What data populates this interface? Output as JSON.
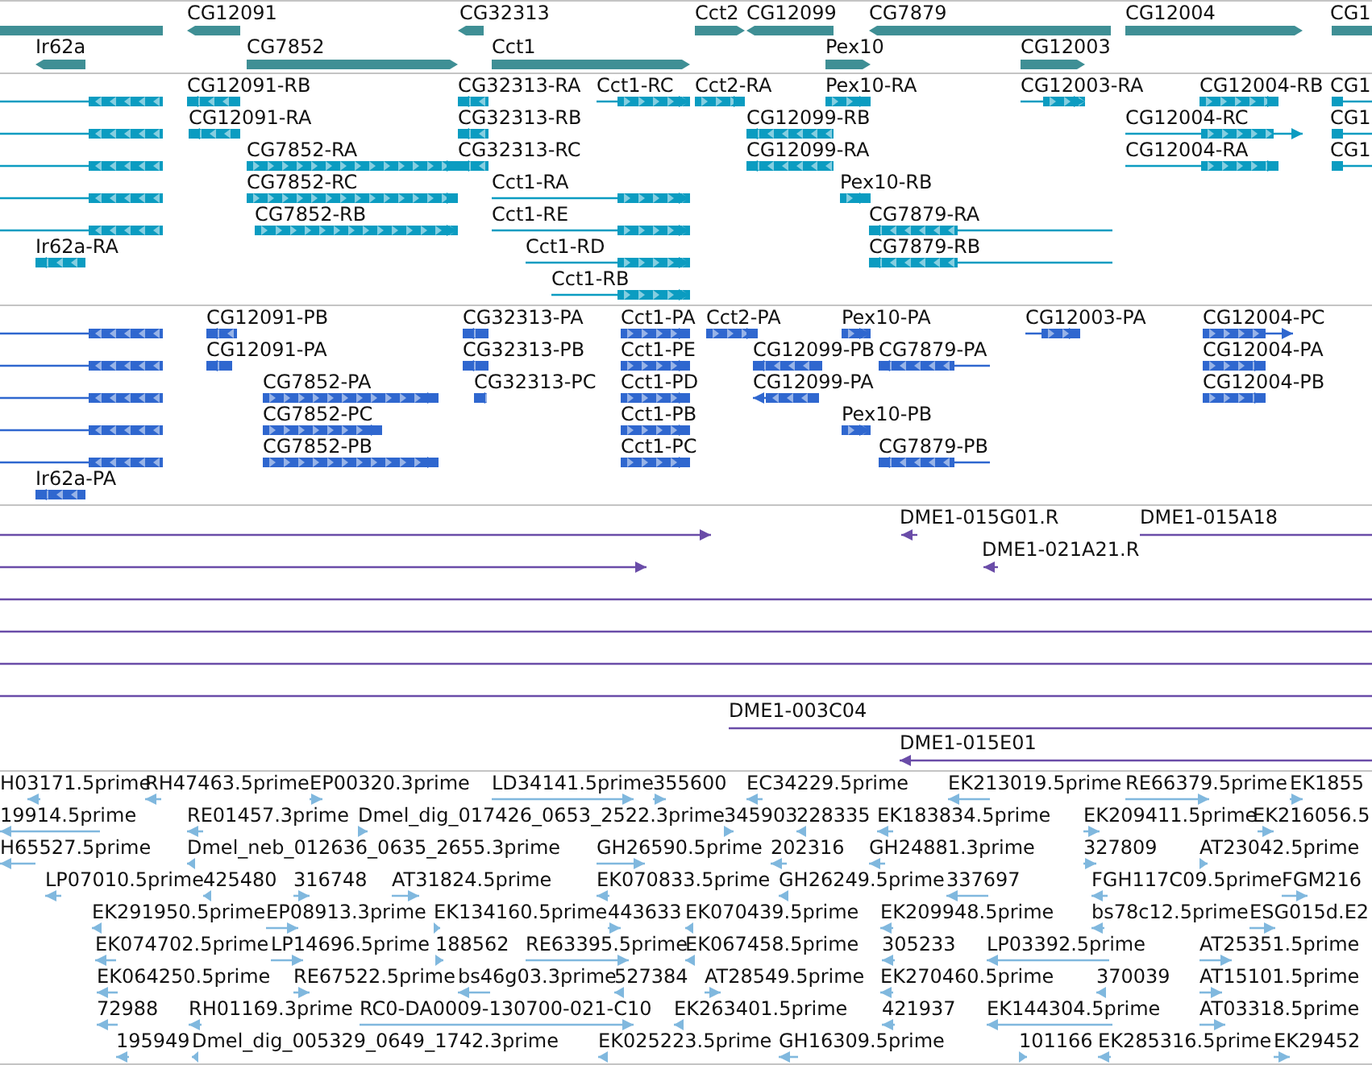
{
  "tracks": [
    {
      "kind": "gene",
      "features": [
        {
          "reverse": true
        },
        {
          "label": "CG12091",
          "reverse": true
        },
        {
          "label": "CG32313",
          "reverse": true
        },
        {
          "label": "Cct2",
          "reverse": false
        },
        {
          "label": "CG12099",
          "reverse": true
        },
        {
          "label": "CG7879",
          "reverse": true
        },
        {
          "label": "CG12004",
          "reverse": false
        },
        {
          "label": "CG1",
          "reverse": false
        },
        {
          "label": "Ir62a",
          "reverse": true
        },
        {
          "label": "CG7852",
          "reverse": false
        },
        {
          "label": "Cct1",
          "reverse": false
        },
        {
          "label": "Pex10",
          "reverse": false
        },
        {
          "label": "CG12003",
          "reverse": false
        }
      ]
    },
    {
      "kind": "transcript",
      "features": [
        {
          "reverse": true
        },
        {
          "label": "CG12091-RB",
          "reverse": true
        },
        {
          "label": "CG32313-RA",
          "reverse": true
        },
        {
          "label": "Cct1-RC",
          "reverse": false
        },
        {
          "label": "Cct2-RA",
          "reverse": false
        },
        {
          "label": "Pex10-RA",
          "reverse": false
        },
        {
          "label": "CG12003-RA",
          "reverse": false
        },
        {
          "label": "CG12004-RB",
          "reverse": false
        },
        {
          "label": "CG1",
          "reverse": false
        },
        {
          "reverse": true
        },
        {
          "label": "CG12091-RA",
          "reverse": true
        },
        {
          "label": "CG32313-RB",
          "reverse": true
        },
        {
          "label": "CG12099-RB",
          "reverse": true
        },
        {
          "label": "CG12004-RC",
          "reverse": false
        },
        {
          "label": "CG1",
          "reverse": false
        },
        {
          "reverse": true
        },
        {
          "label": "CG7852-RA",
          "reverse": false
        },
        {
          "label": "CG32313-RC",
          "reverse": true
        },
        {
          "label": "CG12099-RA",
          "reverse": true
        },
        {
          "label": "CG12004-RA",
          "reverse": false
        },
        {
          "label": "CG1",
          "reverse": false
        },
        {
          "reverse": true
        },
        {
          "label": "CG7852-RC",
          "reverse": false
        },
        {
          "label": "Cct1-RA",
          "reverse": false
        },
        {
          "label": "Pex10-RB",
          "reverse": false
        },
        {
          "reverse": true
        },
        {
          "label": "CG7852-RB",
          "reverse": false
        },
        {
          "label": "Cct1-RE",
          "reverse": false
        },
        {
          "label": "CG7879-RA",
          "reverse": true
        },
        {
          "label": "Ir62a-RA",
          "reverse": true
        },
        {
          "label": "Cct1-RD",
          "reverse": false
        },
        {
          "label": "CG7879-RB",
          "reverse": true
        },
        {
          "label": "Cct1-RB",
          "reverse": false
        }
      ]
    },
    {
      "kind": "protein",
      "features": [
        {
          "reverse": true
        },
        {
          "label": "CG12091-PB",
          "reverse": true
        },
        {
          "label": "CG32313-PA",
          "reverse": true
        },
        {
          "label": "Cct1-PA",
          "reverse": false
        },
        {
          "label": "Cct2-PA",
          "reverse": false
        },
        {
          "label": "Pex10-PA",
          "reverse": false
        },
        {
          "label": "CG12003-PA",
          "reverse": false
        },
        {
          "label": "CG12004-PC",
          "reverse": false
        },
        {
          "reverse": true
        },
        {
          "label": "CG12091-PA",
          "reverse": true
        },
        {
          "label": "CG32313-PB",
          "reverse": true
        },
        {
          "label": "Cct1-PE",
          "reverse": false
        },
        {
          "label": "CG12099-PB",
          "reverse": true
        },
        {
          "label": "CG7879-PA",
          "reverse": true
        },
        {
          "label": "CG12004-PA",
          "reverse": false
        },
        {
          "reverse": true
        },
        {
          "label": "CG7852-PA",
          "reverse": false
        },
        {
          "label": "CG32313-PC",
          "reverse": true
        },
        {
          "label": "Cct1-PD",
          "reverse": false
        },
        {
          "label": "CG12099-PA",
          "reverse": true
        },
        {
          "label": "CG12004-PB",
          "reverse": false
        },
        {
          "reverse": true
        },
        {
          "label": "CG7852-PC",
          "reverse": false
        },
        {
          "label": "Cct1-PB",
          "reverse": false
        },
        {
          "label": "Pex10-PB",
          "reverse": false
        },
        {
          "reverse": true
        },
        {
          "label": "CG7852-PB",
          "reverse": false
        },
        {
          "label": "Cct1-PC",
          "reverse": false
        },
        {
          "label": "CG7879-PB",
          "reverse": true
        },
        {
          "label": "Ir62a-PA",
          "reverse": true
        }
      ]
    },
    {
      "kind": "clone",
      "features": [
        {
          "kind": "clone",
          "reverse": false
        },
        {
          "kind": "clone",
          "label": "DME1-015G01.R",
          "reverse": true
        },
        {
          "kind": "clone",
          "label": "DME1-015A18",
          "reverse": false
        },
        {
          "kind": "clone",
          "reverse": false
        },
        {
          "kind": "clone",
          "label": "DME1-021A21.R",
          "reverse": true
        },
        {
          "kind": "spanning"
        },
        {
          "kind": "spanning"
        },
        {
          "kind": "spanning"
        },
        {
          "kind": "spanning"
        },
        {
          "kind": "clone",
          "label": "DME1-003C04",
          "reverse": false
        },
        {
          "kind": "clone",
          "label": "DME1-015E01",
          "reverse": true
        }
      ]
    },
    {
      "kind": "est",
      "features": [
        {
          "label": "H03171.5prime",
          "reverse": true
        },
        {
          "label": "RH47463.5prime",
          "reverse": true
        },
        {
          "label": "EP00320.3prime",
          "reverse": false
        },
        {
          "label": "LD34141.5prime",
          "reverse": false
        },
        {
          "label": "355600",
          "reverse": false
        },
        {
          "label": "EC34229.5prime",
          "reverse": true
        },
        {
          "label": "EK213019.5prime",
          "reverse": true
        },
        {
          "label": "RE66379.5prime",
          "reverse": false
        },
        {
          "label": "EK1855",
          "reverse": false
        },
        {
          "label": "19914.5prime",
          "reverse": true
        },
        {
          "label": "RE01457.3prime",
          "reverse": true
        },
        {
          "label": "Dmel_dig_017426_0653_2522.3prime",
          "reverse": false
        },
        {
          "label": "345903",
          "reverse": false
        },
        {
          "label": "228335",
          "reverse": true
        },
        {
          "label": "EK183834.5prime",
          "reverse": true
        },
        {
          "label": "EK209411.5prime",
          "reverse": false
        },
        {
          "label": "EK216056.5",
          "reverse": false
        },
        {
          "label": "H65527.5prime",
          "reverse": true
        },
        {
          "label": "Dmel_neb_012636_0635_2655.3prime",
          "reverse": true
        },
        {
          "label": "GH26590.5prime",
          "reverse": false
        },
        {
          "label": "202316",
          "reverse": true
        },
        {
          "label": "GH24881.3prime",
          "reverse": true
        },
        {
          "label": "327809",
          "reverse": false
        },
        {
          "label": "AT23042.5prime",
          "reverse": false
        },
        {
          "label": "LP07010.5prime",
          "reverse": true
        },
        {
          "label": "425480",
          "reverse": true
        },
        {
          "label": "316748",
          "reverse": false
        },
        {
          "label": "AT31824.5prime",
          "reverse": false
        },
        {
          "label": "EK070833.5prime",
          "reverse": true
        },
        {
          "label": "GH26249.5prime",
          "reverse": true
        },
        {
          "label": "337697",
          "reverse": true
        },
        {
          "label": "FGH117C09.5prime",
          "reverse": true
        },
        {
          "label": "FGM216",
          "reverse": false
        },
        {
          "label": "EK291950.5prime",
          "reverse": true
        },
        {
          "label": "EP08913.3prime",
          "reverse": false
        },
        {
          "label": "EK134160.5prime",
          "reverse": false
        },
        {
          "label": "443633",
          "reverse": false
        },
        {
          "label": "EK070439.5prime",
          "reverse": true
        },
        {
          "label": "EK209948.5prime",
          "reverse": true
        },
        {
          "label": "bs78c12.5prime",
          "reverse": true
        },
        {
          "label": "ESG015d.E2",
          "reverse": false
        },
        {
          "label": "EK074702.5prime",
          "reverse": true
        },
        {
          "label": "LP14696.5prime",
          "reverse": false
        },
        {
          "label": "188562",
          "reverse": false
        },
        {
          "label": "RE63395.5prime",
          "reverse": false
        },
        {
          "label": "EK067458.5prime",
          "reverse": true
        },
        {
          "label": "305233",
          "reverse": true
        },
        {
          "label": "LP03392.5prime",
          "reverse": true
        },
        {
          "label": "AT25351.5prime",
          "reverse": false
        },
        {
          "label": "EK064250.5prime",
          "reverse": true
        },
        {
          "label": "RE67522.5prime",
          "reverse": false
        },
        {
          "label": "bs46g03.3prime",
          "reverse": true
        },
        {
          "label": "527384",
          "reverse": true
        },
        {
          "label": "AT28549.5prime",
          "reverse": false
        },
        {
          "label": "EK270460.5prime",
          "reverse": true
        },
        {
          "label": "370039",
          "reverse": true
        },
        {
          "label": "AT15101.5prime",
          "reverse": false
        },
        {
          "label": "72988",
          "reverse": true
        },
        {
          "label": "RH01169.3prime",
          "reverse": true
        },
        {
          "label": "RC0-DA0009-130700-021-C10",
          "reverse": false
        },
        {
          "label": "EK263401.5prime",
          "reverse": true
        },
        {
          "label": "421937",
          "reverse": true
        },
        {
          "label": "EK144304.5prime",
          "reverse": true
        },
        {
          "label": "AT03318.5prime",
          "reverse": false
        },
        {
          "label": "195949",
          "reverse": true
        },
        {
          "label": "Dmel_dig_005329_0649_1742.3prime",
          "reverse": true
        },
        {
          "label": "EK025223.5prime",
          "reverse": true
        },
        {
          "label": "GH16309.5prime",
          "reverse": true
        },
        {
          "label": "101166",
          "reverse": false
        },
        {
          "label": "EK285316.5prime",
          "reverse": true
        },
        {
          "label": "EK29452",
          "reverse": false
        }
      ]
    }
  ]
}
